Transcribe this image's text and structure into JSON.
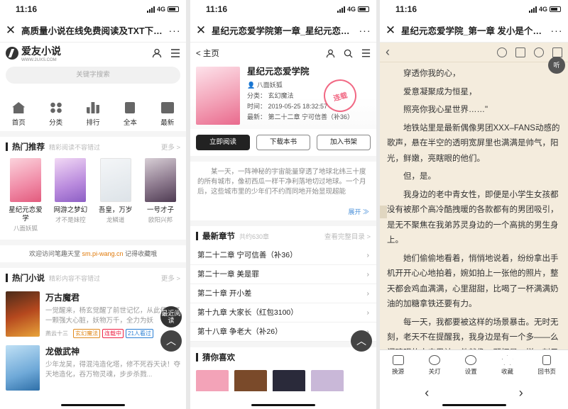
{
  "status": {
    "time": "11:16",
    "network": "4G"
  },
  "p1": {
    "title": "高质量小说在线免费阅读及TXT下载 -...",
    "logo": "爱友小说",
    "logo_sub": "WWW.2UXS.COM",
    "search_placeholder": "关键字搜索",
    "nav": [
      "首页",
      "分类",
      "排行",
      "全本",
      "最新"
    ],
    "rec": {
      "title": "热门推荐",
      "sub": "精彩阅读不容错过",
      "more": "更多 >"
    },
    "rec_books": [
      {
        "name": "星纪元恋爱学",
        "author": "八面妖狐",
        "color": "#f4a6b8"
      },
      {
        "name": "网游之梦幻",
        "author": "才不是妹控",
        "color": "#c99be0"
      },
      {
        "name": "吾皇，万岁",
        "author": "龙鳞道",
        "color": "#dfe4ea"
      },
      {
        "name": "一号才子",
        "author": "欧阳兴邦",
        "color": "#8a7a90"
      }
    ],
    "banner_pre": "欢迎访问笔趣天堂",
    "banner_site": "sm.pi-wang.cn",
    "banner_post": "记得收藏哦",
    "hot": {
      "title": "热门小说",
      "sub": "精彩内容不容错过",
      "more": "更多 >"
    },
    "hot_books": [
      {
        "name": "万古魔君",
        "desc": "一觉醒来，杨玄觉醒了前世记忆，从此便有了一颗强大心脏，妖物万千，全力为妖",
        "author": "燕云十三",
        "tag1": "玄幻魔法",
        "tag2": "连载中",
        "tag3": "21人看过"
      },
      {
        "name": "龙傲武神",
        "desc": "少年龙昊，得混沌造化塔，修不死吞天诀！夺天地造化，吞万物灵魂，步步杀戮...",
        "author": "",
        "tag1": "",
        "tag2": "",
        "tag3": ""
      }
    ],
    "float_label": "最近阅读",
    "top_label": "︿"
  },
  "p2": {
    "title": "星纪元恋爱学院第一章_星纪元恋爱学院T...",
    "back": "< 主页",
    "book": {
      "name": "星纪元恋爱学院",
      "author": "八面妖狐",
      "category": "分类：  玄幻魔法",
      "time": "时间：  2019-05-25 18:32:57",
      "latest": "最新：  第二十二章 宁可信善（补36）"
    },
    "stamp": "连载",
    "buttons": [
      "立即阅读",
      "下载本书",
      "加入书架"
    ],
    "intro": "某一天，一阵神秘的宇宙能量穿透了地球北纬三十度的所有城市，像初西瓜一样干净利落地切过地球。一个月后，这些城市里的少年们不约而同地开始显现超能",
    "unfold": "展开 ≫",
    "latest": {
      "title": "最新章节",
      "sub": "共约630章",
      "more": "查看完整目录 >"
    },
    "chapters": [
      "第二十二章 宁可信善（补36）",
      "第二十一章 美是罪",
      "第二十章 开小差",
      "第十九章 大家长（红包3100）",
      "第十八章 争老大（补26）"
    ],
    "guess": {
      "title": "猜你喜欢"
    }
  },
  "p3": {
    "title": "星纪元恋爱学院_第一章 发小是个中二...",
    "listen": "听",
    "paragraphs": [
      "穿透你我的心，",
      "爱意凝聚成为恒星，",
      "照亮你我心星世界……\"",
      "地铁站里是最新偶像男团XXX–FANS动感的歌声，悬在半空的透明宽屏里也满满是帅气，阳光，鲜嫩，亮瞎眼的他们。",
      "但，是。",
      "我身边的老中青女性，即便是小学生女孩都没有被那个高冷酷拽暖的各款都有的男团吸引，是无不聚焦在我弟苏灵身边的一个高挑的男生身上。",
      "她们偷偷地看着，悄悄地说着，纷纷拿出手机开开心心地拍着，婉如拍上一张他的照片，整天都会鸡血满满，心里甜甜，比喝了一杯满满奶油的加糖拿铁还要有力。",
      "每一天，我都要被这样的场景暴击。无时无刻，老天不在提醒我，我身边是有一个多——么闪瞎眼的未来男神，他就像一颗恒星一样，刺目的光芒撑满我的世界，让我在他身边时，有如一个空气，不被别人看见，即便他们拍照时我总被"
    ],
    "bottom": [
      "换源",
      "关灯",
      "设置",
      "收藏",
      "回书页"
    ]
  }
}
